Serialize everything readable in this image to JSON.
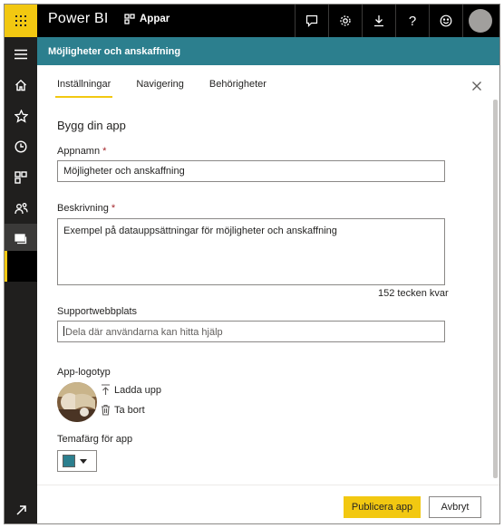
{
  "topbar": {
    "brand": "Power BI",
    "apps_label": "Appar",
    "help_glyph": "?",
    "icons": [
      "waffle-icon",
      "apps-icon",
      "chat-icon",
      "gear-icon",
      "download-icon",
      "help-icon",
      "smiley-icon",
      "avatar"
    ]
  },
  "rail": {
    "icons": [
      "hamburger-icon",
      "home-icon",
      "star-icon",
      "clock-icon",
      "apps-icon",
      "shared-icon",
      "workspaces-icon",
      "expand-icon"
    ]
  },
  "header": {
    "title": "Möjligheter och anskaffning"
  },
  "tabs": [
    {
      "label": "Inställningar",
      "active": true
    },
    {
      "label": "Navigering",
      "active": false
    },
    {
      "label": "Behörigheter",
      "active": false
    }
  ],
  "form": {
    "section_title": "Bygg din app",
    "app_name": {
      "label": "Appnamn",
      "required_mark": "*",
      "value": "Möjligheter och anskaffning"
    },
    "description": {
      "label": "Beskrivning",
      "required_mark": "*",
      "value": "Exempel på datauppsättningar för möjligheter och anskaffning",
      "counter": "152 tecken kvar"
    },
    "support": {
      "label": "Supportwebbplats",
      "placeholder": "Dela där användarna kan hitta hjälp"
    },
    "logo": {
      "label": "App-logotyp",
      "upload_label": "Ladda upp",
      "delete_label": "Ta bort"
    },
    "theme": {
      "label": "Temafärg för app",
      "color": "#2c7f8e"
    }
  },
  "footer": {
    "publish_label": "Publicera app",
    "cancel_label": "Avbryt"
  },
  "colors": {
    "accent": "#f2c811",
    "header": "#2c7f8e",
    "topbar": "#000000",
    "rail": "#201f1e"
  }
}
